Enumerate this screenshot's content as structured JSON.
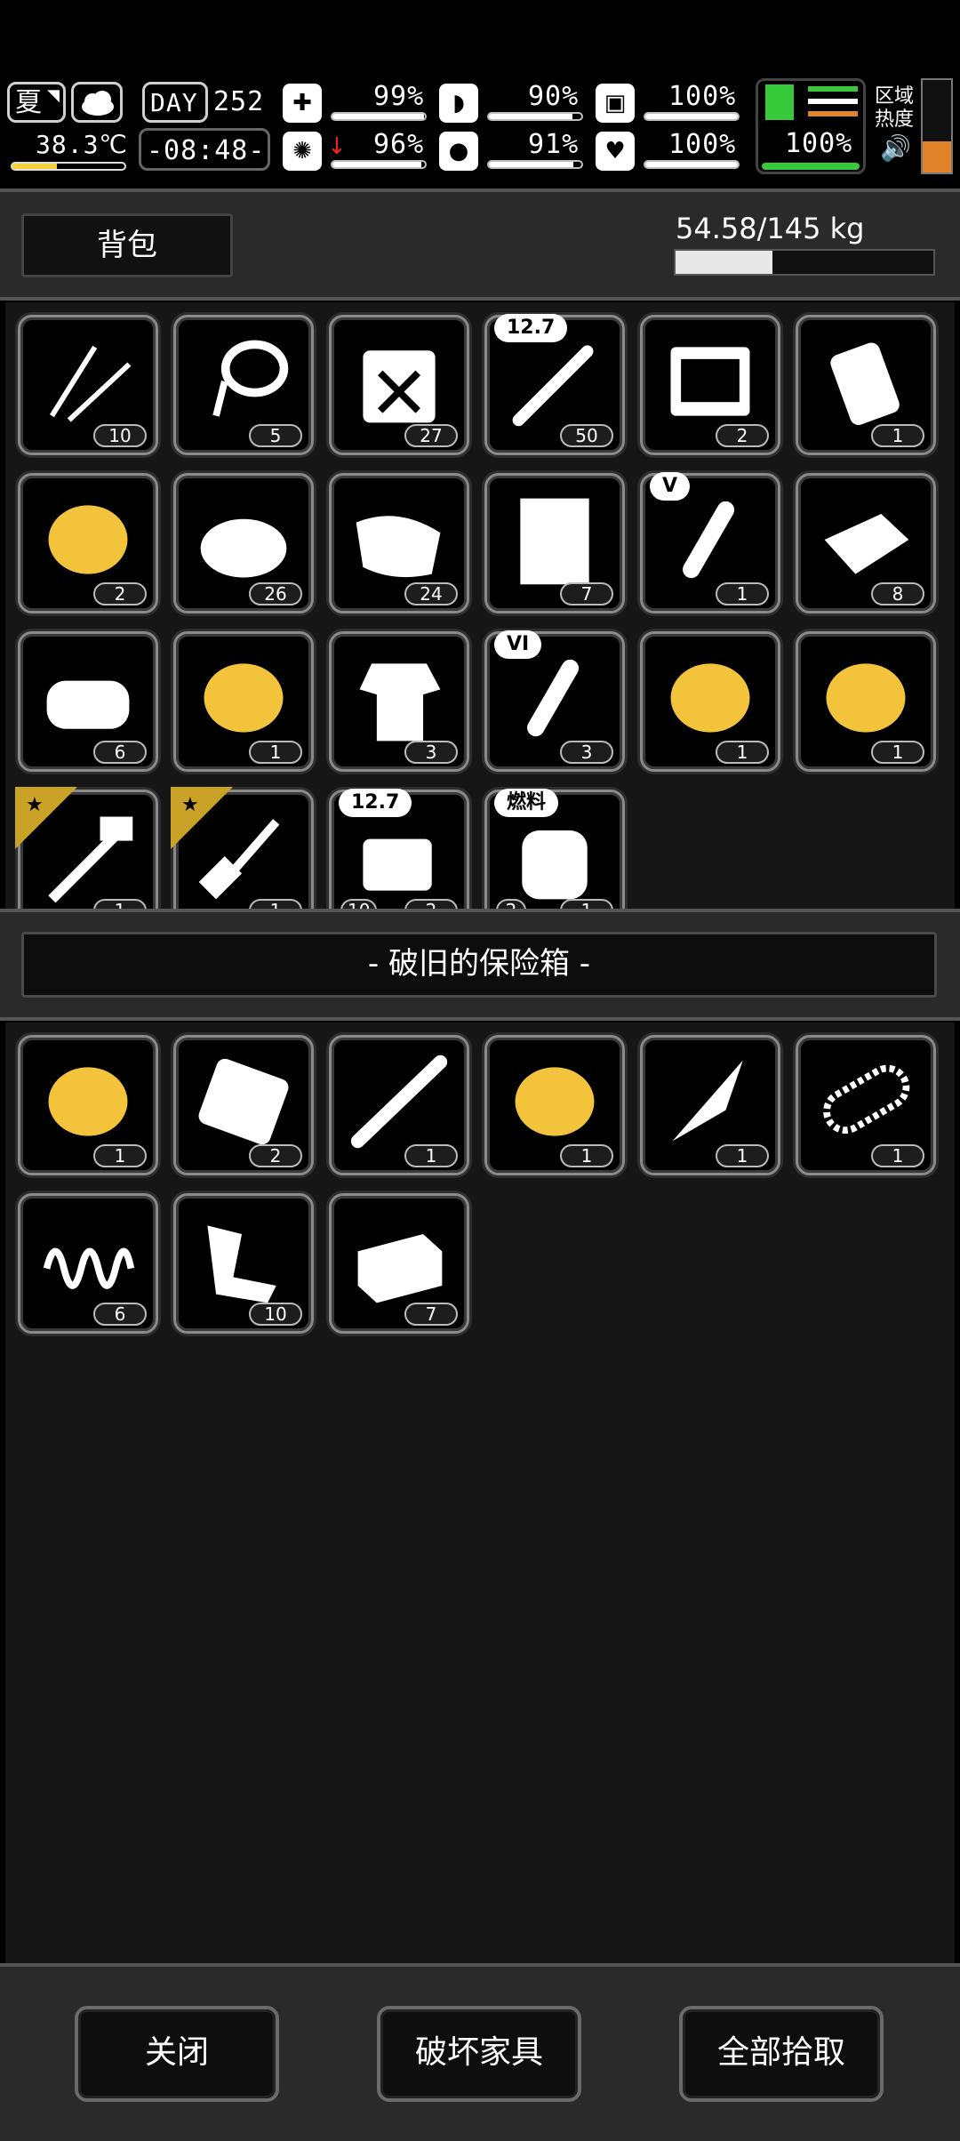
{
  "hud": {
    "season": "夏",
    "temperature": "38.3℃",
    "day_label": "DAY",
    "day_number": "252",
    "time": "-08:48-",
    "stats": [
      {
        "name": "health",
        "value": "99%",
        "fill": 0.99
      },
      {
        "name": "hunger",
        "value": "90%",
        "fill": 0.9
      },
      {
        "name": "energy",
        "value": "100%",
        "fill": 1.0
      },
      {
        "name": "sanity",
        "value": "96%",
        "fill": 0.96
      },
      {
        "name": "thirst",
        "value": "91%",
        "fill": 0.91
      },
      {
        "name": "heart",
        "value": "100%",
        "fill": 1.0
      }
    ],
    "stamina": "100%",
    "zone_heat_label": "区域\n热度",
    "accent_green": "#36c93a",
    "accent_orange": "#e0822a"
  },
  "backpack": {
    "title": "背包",
    "weight": "54.58/145 kg",
    "weight_fill": 0.376
  },
  "bag_items": [
    {
      "icon": "lockpick-icon",
      "count": "10"
    },
    {
      "icon": "rope-icon",
      "count": "5"
    },
    {
      "icon": "empty-jerrycan-icon",
      "count": "27"
    },
    {
      "icon": "rifle-bullet-icon",
      "count": "50",
      "tag": "12.7"
    },
    {
      "icon": "toolkit-icon",
      "count": "2"
    },
    {
      "icon": "paper-roll-icon",
      "count": "1"
    },
    {
      "icon": "gold-crystal-icon",
      "count": "2"
    },
    {
      "icon": "cloth-pile-icon",
      "count": "26"
    },
    {
      "icon": "sandbag-icon",
      "count": "24"
    },
    {
      "icon": "paper-sheet-icon",
      "count": "7"
    },
    {
      "icon": "test-tube-v-icon",
      "count": "1",
      "tag": "V"
    },
    {
      "icon": "folded-cloth-icon",
      "count": "8"
    },
    {
      "icon": "towel-icon",
      "count": "6"
    },
    {
      "icon": "gold-spool-icon",
      "count": "1"
    },
    {
      "icon": "torn-shirt-icon",
      "count": "3"
    },
    {
      "icon": "test-tube-vi-icon",
      "count": "3",
      "tag": "VI"
    },
    {
      "icon": "gold-cloth-icon",
      "count": "1"
    },
    {
      "icon": "gold-coil-icon",
      "count": "1"
    },
    {
      "icon": "hatchet-icon",
      "count": "1",
      "star": true
    },
    {
      "icon": "shovel-icon",
      "count": "1",
      "star": true
    },
    {
      "icon": "heavy-rifle-icon",
      "count": "2",
      "tag": "12.7",
      "ammo": "10"
    },
    {
      "icon": "fuel-canister-icon",
      "count": "1",
      "tag": "燃料",
      "ammo": "2"
    }
  ],
  "chest": {
    "title": "- 破旧的保险箱 -"
  },
  "chest_items": [
    {
      "icon": "gold-ore-icon",
      "count": "1"
    },
    {
      "icon": "metal-plate-icon",
      "count": "2"
    },
    {
      "icon": "pipe-icon",
      "count": "1"
    },
    {
      "icon": "gold-plate-icon",
      "count": "1"
    },
    {
      "icon": "knife-blade-icon",
      "count": "1"
    },
    {
      "icon": "chainsaw-chain-icon",
      "count": "1"
    },
    {
      "icon": "spring-icon",
      "count": "6"
    },
    {
      "icon": "scrap-metal-icon",
      "count": "10"
    },
    {
      "icon": "brick-icon",
      "count": "7"
    }
  ],
  "footer": {
    "close": "关闭",
    "destroy": "破坏家具",
    "take_all": "全部拾取"
  }
}
